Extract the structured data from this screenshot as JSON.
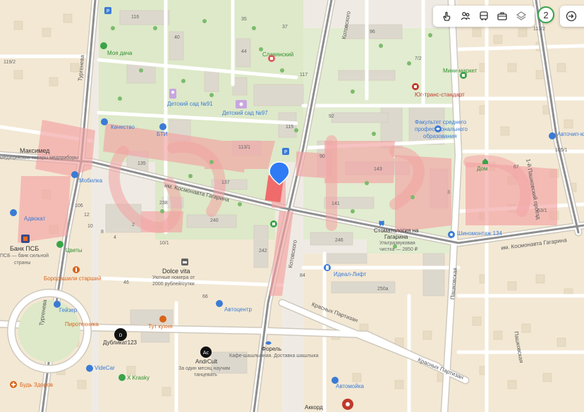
{
  "toolbar": {
    "badge_count": "2",
    "icons": [
      "hand-touch-icon",
      "people-icon",
      "bus-icon",
      "briefcase-icon",
      "layers-icon"
    ]
  },
  "streets": {
    "kosmonavta_gagarina": "им. Космонавта Гагарина",
    "kosmonavta_gagarina_east": "им. Космонавта Гагарина",
    "turgeneva": "Тургенева",
    "turgeneva_south": "Тургенева",
    "kotovskogo": "Котовского",
    "kotovskogo_north": "Котовского",
    "krasnykh_partizan": "Красных Партизан",
    "krasnykh_partizan_2": "Красных Партизан",
    "pashkovskaya": "Пашковская",
    "pashkovskaya_north": "Пашковская",
    "pashkovsky_proezd": "1-й Пашковский проезд"
  },
  "places": {
    "moya_dacha": "Моя дача",
    "slavyansky": "Славянский",
    "detsad_91": "Детский сад №91",
    "detsad_97": "Детский сад №97",
    "kachestvo": "Качество",
    "bti": "БТИ",
    "maksimed": "Максимед",
    "maksimed_desc": "медицинские товары медприборы",
    "mobilka": "Мобилка",
    "advokat": "Адвокат",
    "bank_psb": "Банк ПСБ",
    "bank_psb_desc1": "ПСБ — банк сильной",
    "bank_psb_desc2": "страны",
    "tsvety": "Цветы",
    "dolce_vita": "Dolce vita",
    "dolce_vita_desc1": "Уютные номера от",
    "dolce_vita_desc2": "2000 рублей/сутки",
    "borodashili": "Бородашили старший",
    "geyzer": "Гейзер",
    "pirotekhnika": "Пиротехника",
    "tut_kukhnya": "Тут кухня",
    "dublikat": "Дубликат123",
    "andrcult": "AndrCult",
    "andrcult_desc1": "За один месяц научим",
    "andrcult_desc2": "танцевать",
    "videcar": "VideCar",
    "x_krasky": "X Krasky",
    "bud_zdorov": "Будь Здоров",
    "forel": "Форель",
    "forel_desc": "Кафе-шашлычная. Доставка шашлыка",
    "avtocentr": "Автоцентр",
    "ideal_lift": "Идеал-Лифт",
    "stomatologiya": "Стоматология на",
    "stomatologiya_2": "Гагарина",
    "stomatologiya_desc1": "Ультразвуковая",
    "stomatologiya_desc2": "чистка — 2850 ₽",
    "shinomontazh": "Шиномонтаж 134",
    "dom": "Дом",
    "fakultet": "Факультет среднего",
    "fakultet_2": "профессионального",
    "fakultet_3": "образования",
    "yug_trans": "Юг-транс-стандарт",
    "mini_market": "Мини-маркет",
    "avtochip": "Авточип-юг",
    "avtomoyka": "Автомойка",
    "akkord": "Аккорд"
  },
  "numbers": {
    "n116": "116",
    "n35": "35",
    "n37": "37",
    "n96": "96",
    "n7_2": "7/2",
    "n40": "40",
    "n44": "44",
    "n117": "117",
    "n115": "115",
    "n92": "92",
    "n113_1": "113/1",
    "n90": "90",
    "n143": "143",
    "n135": "135",
    "n137": "137",
    "n141": "141",
    "n238": "238",
    "n240": "240",
    "n106": "106",
    "n242": "242",
    "n246": "246",
    "n10_1": "10/1",
    "n84": "84",
    "n250a": "250а",
    "n46": "46",
    "n66": "66",
    "n105_1": "105/1",
    "n67": "67",
    "n63_1": "63/1",
    "n3": "3",
    "n119_2": "119/2",
    "n113_2": "113/2",
    "n10": "10",
    "n4": "4",
    "n2": "2",
    "n8": "8",
    "n12": "12"
  },
  "colors": {
    "background": "#efebe4",
    "block": "#f4ead6",
    "building": "#dcd7cc",
    "green_area": "#dbe9c6",
    "road": "#ffffff",
    "road_edge": "#cfc9bd",
    "main_road": "#9b9b9b",
    "highlight": "#f06b6b",
    "marker": "#2f7bf5",
    "badge_ring": "#39a44a"
  }
}
